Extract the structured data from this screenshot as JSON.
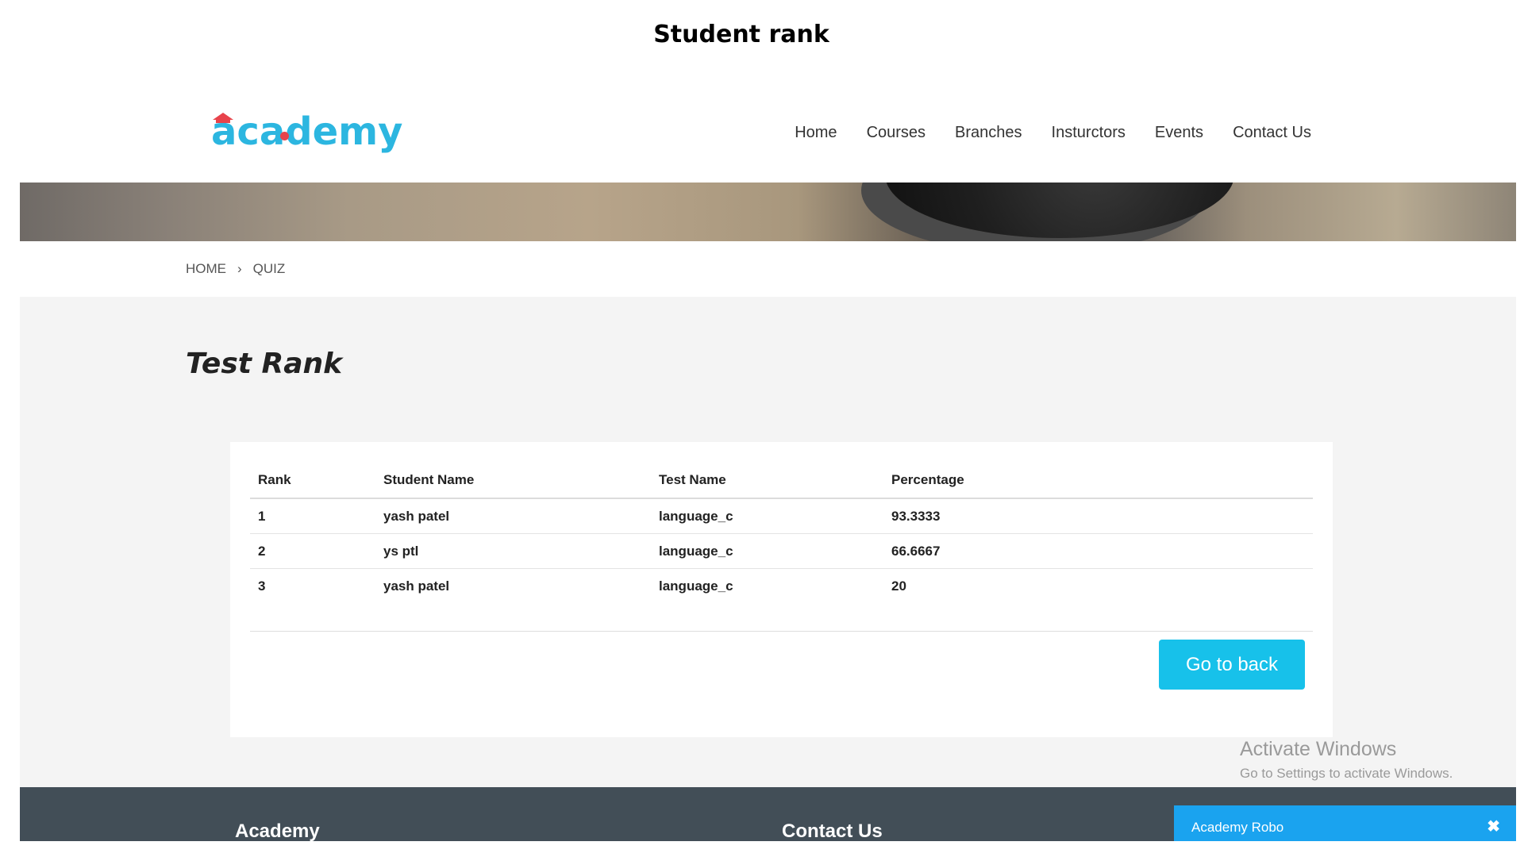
{
  "doc_title": "Student rank",
  "header": {
    "logo_text": "academy",
    "nav": [
      "Home",
      "Courses",
      "Branches",
      "Insturctors",
      "Events",
      "Contact Us"
    ]
  },
  "breadcrumb": {
    "home": "HOME",
    "separator": "›",
    "current": "QUIZ"
  },
  "main": {
    "title": "Test Rank",
    "table": {
      "headers": [
        "Rank",
        "Student Name",
        "Test Name",
        "Percentage"
      ],
      "rows": [
        [
          "1",
          "yash patel",
          "language_c",
          "93.3333"
        ],
        [
          "2",
          "ys ptl",
          "language_c",
          "66.6667"
        ],
        [
          "3",
          "yash patel",
          "language_c",
          "20"
        ]
      ]
    },
    "back_button": "Go to back"
  },
  "watermark": {
    "title": "Activate Windows",
    "subtitle": "Go to Settings to activate Windows."
  },
  "footer": {
    "col1_title": "Academy",
    "col2_title": "Contact Us"
  },
  "chat": {
    "title": "Academy Robo",
    "close_icon": "✖"
  },
  "colors": {
    "accent": "#17c1ea",
    "logo": "#2cb6e0",
    "logo_accent": "#e8434b",
    "footer": "#424e57",
    "chat": "#1aa3ef"
  }
}
